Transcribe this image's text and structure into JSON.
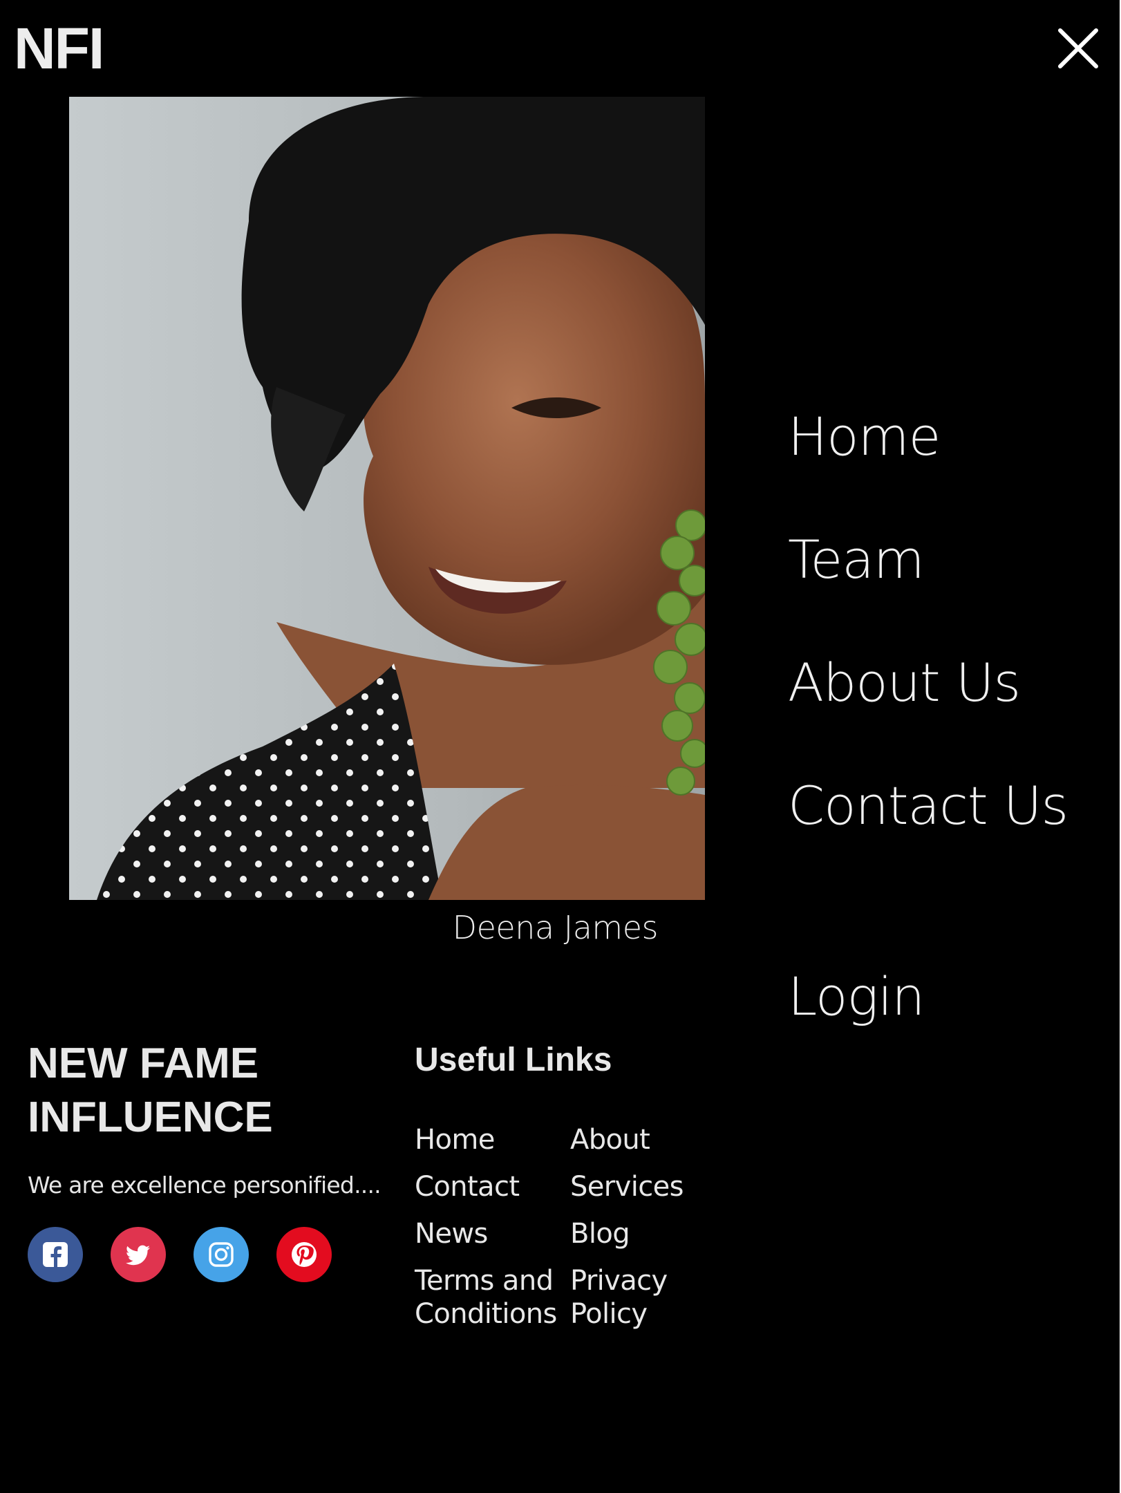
{
  "header": {
    "logo": "NFI",
    "close_icon": "close-icon"
  },
  "photo": {
    "caption": "Deena James"
  },
  "menu": {
    "items": [
      {
        "label": "Home"
      },
      {
        "label": "Team"
      },
      {
        "label": "About Us"
      },
      {
        "label": "Contact Us"
      },
      {
        "label": "Login"
      }
    ]
  },
  "footer": {
    "brand": "NEW FAME INFLUENCE",
    "tagline": "We are excellence personified....",
    "social": [
      {
        "icon": "facebook-icon",
        "color": "#3b5998"
      },
      {
        "icon": "twitter-icon",
        "color": "#e0344f"
      },
      {
        "icon": "instagram-icon",
        "color": "#46a3e8"
      },
      {
        "icon": "pinterest-icon",
        "color": "#e30c1f"
      }
    ],
    "links_heading": "Useful Links",
    "links": [
      {
        "label": "Home"
      },
      {
        "label": "About"
      },
      {
        "label": "Contact"
      },
      {
        "label": "Services"
      },
      {
        "label": "News"
      },
      {
        "label": "Blog"
      },
      {
        "label": "Terms and Conditions"
      },
      {
        "label": "Privacy Policy"
      }
    ]
  },
  "colors": {
    "background": "#000000",
    "text": "#f0f0f0"
  }
}
